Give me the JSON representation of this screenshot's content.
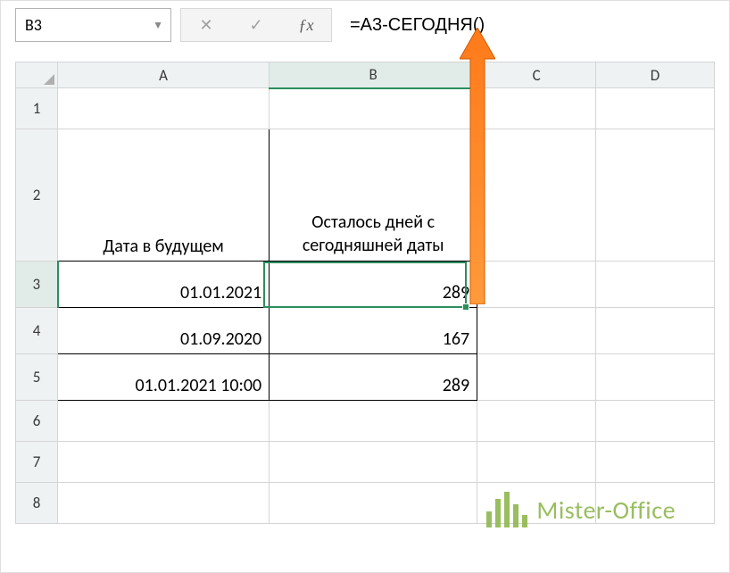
{
  "nameBox": {
    "value": "B3"
  },
  "formulaBar": {
    "formula": "=A3-СЕГОДНЯ()"
  },
  "fnLabel": "ƒx",
  "columns": [
    "A",
    "B",
    "C",
    "D"
  ],
  "rows": [
    "1",
    "2",
    "3",
    "4",
    "5",
    "6",
    "7",
    "8"
  ],
  "headers": {
    "A2": "Дата в будущем",
    "B2": "Осталось дней с сегодняшней даты"
  },
  "cells": {
    "A3": "01.01.2021",
    "B3": "289",
    "A4": "01.09.2020",
    "B4": "167",
    "A5": "01.01.2021 10:00",
    "B5": "289"
  },
  "watermark": "Mister-Office"
}
